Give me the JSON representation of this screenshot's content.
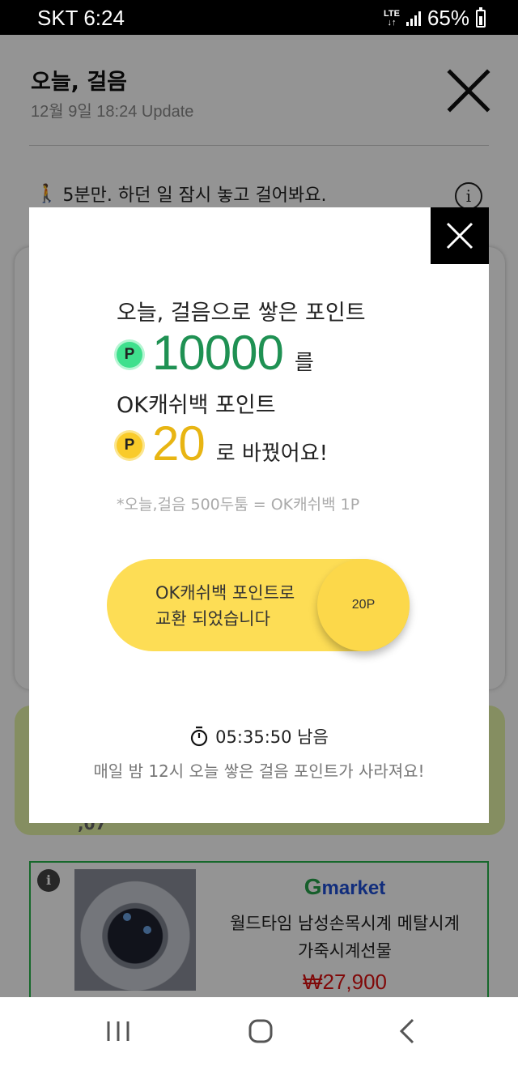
{
  "status_bar": {
    "carrier_time": "SKT 6:24",
    "network": "LTE",
    "battery": "65%",
    "icons": [
      "signal-icon",
      "battery-icon"
    ]
  },
  "header": {
    "title": "오늘, 걸음",
    "updated": "12월 9일 18:24 Update"
  },
  "walk_message": "5분만. 하던 일 잠시 놓고 걸어봐요.",
  "background_card": {
    "partial_text": ",07"
  },
  "ad": {
    "brand": "market",
    "brand_g": "G",
    "product_line1": "월드타임 남성손목시계 메탈시계",
    "product_line2": "가죽시계선물",
    "price": "₩27,900"
  },
  "modal": {
    "line1": "오늘, 걸음으로 쌓은 포인트",
    "coin_p": "P",
    "points_from": "10000",
    "suffix_from": "를",
    "line3": "OK캐쉬백 포인트",
    "points_to": "20",
    "suffix_to": "로 바꿨어요!",
    "note": "*오늘,걸음 500두툼 = OK캐쉬백 1P",
    "exchange_line1": "OK캐쉬백 포인트로",
    "exchange_line2": "교환 되었습니다",
    "exchange_badge": "20P",
    "timer": "05:35:50 남음",
    "footer": "매일 밤 12시 오늘 쌓은 걸음 포인트가 사라져요!"
  },
  "colors": {
    "green_points": "#1f9153",
    "yellow_points": "#e8b513",
    "pill": "#fddd55",
    "ad_border": "#27b34b",
    "price": "#dd1111"
  }
}
